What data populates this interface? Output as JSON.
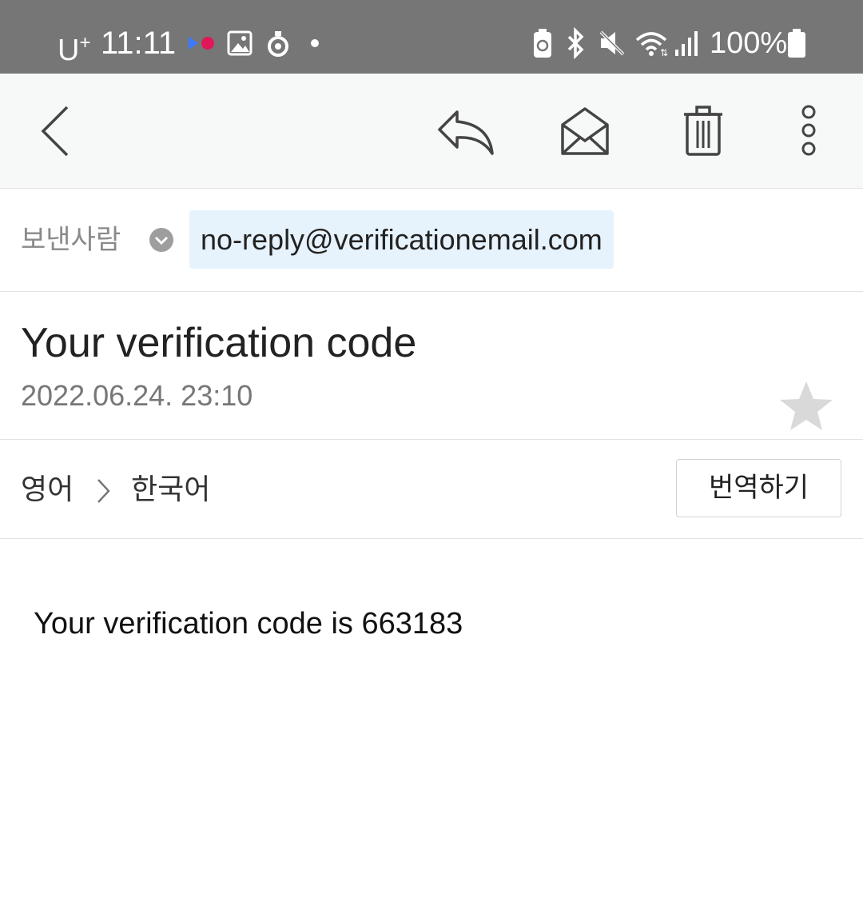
{
  "status_bar": {
    "carrier": "U",
    "carrier_sup": "+",
    "time": "11:11",
    "battery_percent": "100%",
    "icons": [
      "media-play-record-icon",
      "gallery-icon",
      "location-icon",
      "dot-icon",
      "battery-saver-icon",
      "bluetooth-icon",
      "mute-icon",
      "wifi-icon",
      "signal-icon",
      "battery-icon"
    ]
  },
  "toolbar": {
    "icons": [
      "back-icon",
      "reply-icon",
      "mark-unread-icon",
      "trash-icon",
      "more-icon"
    ]
  },
  "sender": {
    "label": "보낸사람",
    "email": "no-reply@verificationemail.com"
  },
  "message": {
    "subject": "Your verification code",
    "date": "2022.06.24. 23:10",
    "starred": false,
    "body": "Your verification code is 663183"
  },
  "translate": {
    "from": "영어",
    "to": "한국어",
    "button_label": "번역하기"
  },
  "colors": {
    "status_bar_bg": "#767676",
    "toolbar_bg": "#f7f8f8",
    "sender_chip_bg": "#e6f2fc",
    "star_color": "#d9d9d9"
  }
}
